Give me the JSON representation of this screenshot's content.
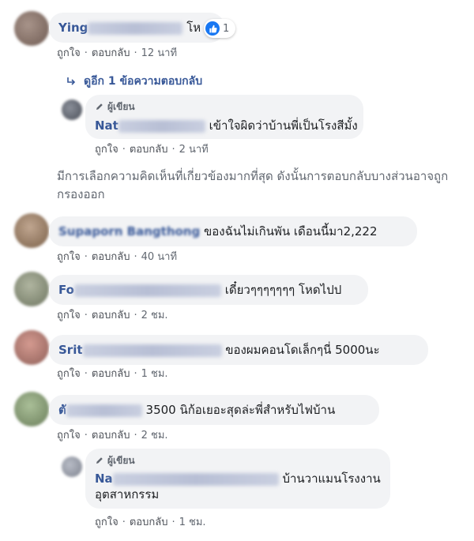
{
  "comments": [
    {
      "name_visible": "Ying",
      "text": "โห",
      "reactions": "1",
      "like": "ถูกใจ",
      "reply": "ตอบกลับ",
      "time": "12 นาที"
    },
    {
      "name_visible": "Supaporn Bangthong",
      "text": "ของฉันไม่เกินพัน เดือนนี้มา2,222",
      "like": "ถูกใจ",
      "reply": "ตอบกลับ",
      "time": "40 นาที"
    },
    {
      "name_visible": "Fo",
      "text": "เดี๋ยวๆๆๆๆๆๆๆ โหดไปป",
      "like": "ถูกใจ",
      "reply": "ตอบกลับ",
      "time": "2 ชม."
    },
    {
      "name_visible": "Srit",
      "text": "ของผมคอนโดเล็กๆนี่ 5000นะ",
      "like": "ถูกใจ",
      "reply": "ตอบกลับ",
      "time": "1 ชม."
    },
    {
      "name_visible": "ตั",
      "text": "3500 นิก้อเยอะสุดล่ะพี่สำหรับไฟบ้าน",
      "like": "ถูกใจ",
      "reply": "ตอบกลับ",
      "time": "2 ชม."
    }
  ],
  "replies_link": "ดูอีก 1 ข้อความตอบกลับ",
  "author_reply_1": {
    "author_label": "ผู้เขียน",
    "name_visible": "Nat",
    "text": "เข้าใจผิดว่าบ้านพี่เป็นโรงสีมั้ง",
    "like": "ถูกใจ",
    "reply": "ตอบกลับ",
    "time": "2 นาที"
  },
  "notice": "มีการเลือกความคิดเห็นที่เกี่ยวข้องมากที่สุด ดังนั้นการตอบกลับบางส่วนอาจถูกกรองออก",
  "author_reply_2": {
    "author_label": "ผู้เขียน",
    "name_visible": "Na",
    "text_line1": "บ้านวาแมนโรงงาน",
    "text_line2": "อุตสาหกรรม",
    "like": "ถูกใจ",
    "reply": "ตอบกลับ",
    "time": "1 ชม."
  },
  "colors": {
    "link": "#385898",
    "bubble": "#f2f3f5",
    "meta": "#616770",
    "like_blue": "#1877f2"
  }
}
